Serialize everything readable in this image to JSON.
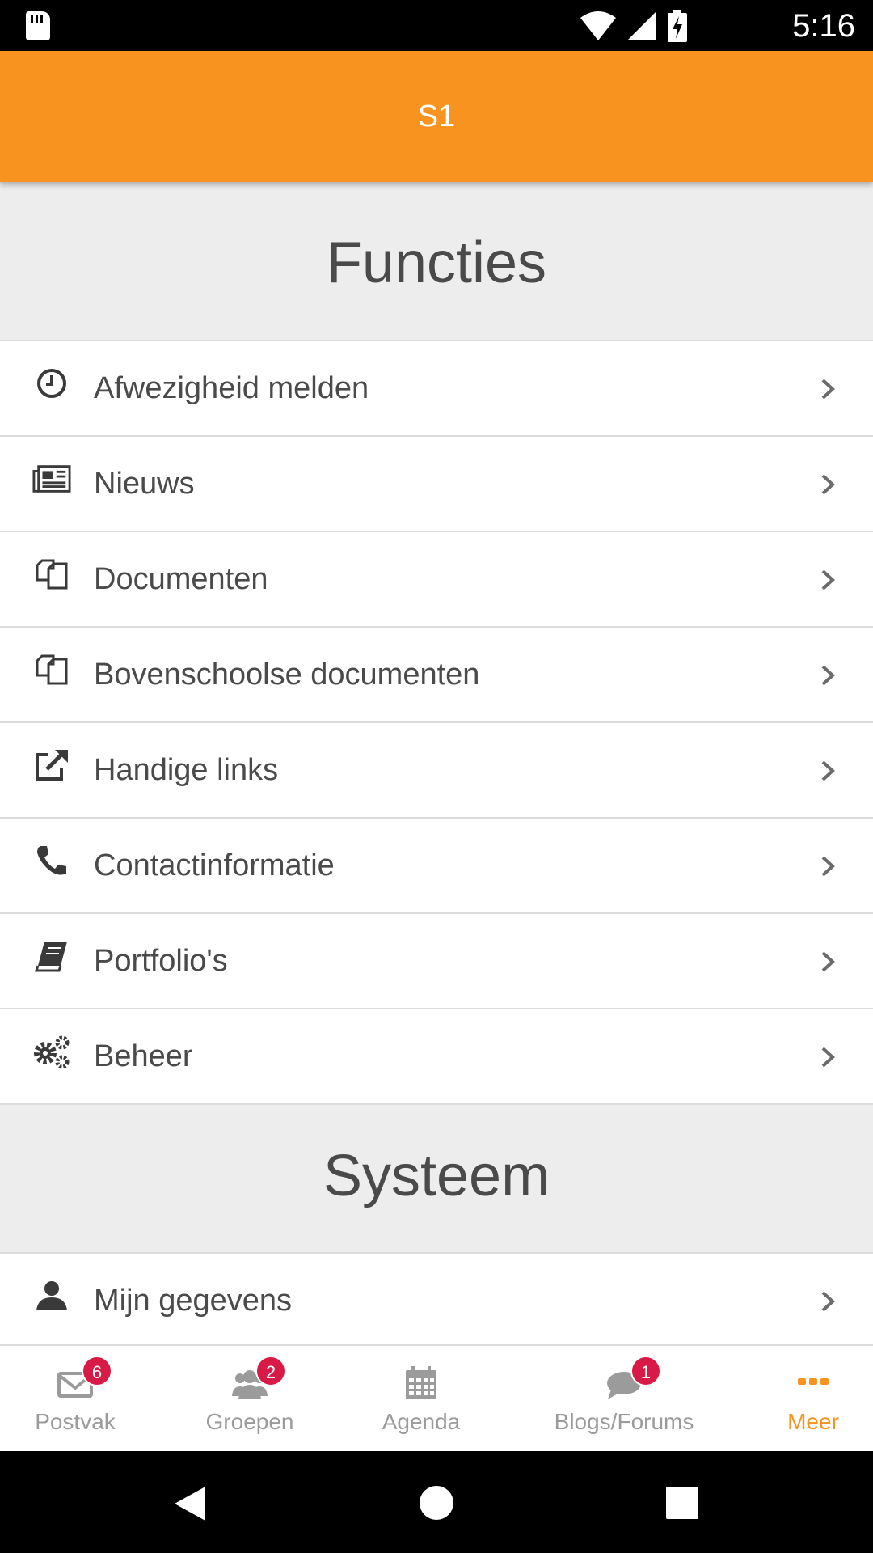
{
  "status_bar": {
    "time": "5:16"
  },
  "app_bar": {
    "title": "S1"
  },
  "sections": {
    "functions_title": "Functies",
    "system_title": "Systeem"
  },
  "functions": [
    {
      "label": "Afwezigheid melden",
      "icon": "clock-icon"
    },
    {
      "label": "Nieuws",
      "icon": "newspaper-icon"
    },
    {
      "label": "Documenten",
      "icon": "documents-icon"
    },
    {
      "label": "Bovenschoolse documenten",
      "icon": "documents-icon"
    },
    {
      "label": "Handige links",
      "icon": "external-link-icon"
    },
    {
      "label": "Contactinformatie",
      "icon": "phone-icon"
    },
    {
      "label": "Portfolio's",
      "icon": "book-icon"
    },
    {
      "label": "Beheer",
      "icon": "gears-icon"
    }
  ],
  "system": [
    {
      "label": "Mijn gegevens",
      "icon": "user-icon"
    }
  ],
  "bottom_nav": [
    {
      "label": "Postvak",
      "icon": "envelope-icon",
      "badge": "6"
    },
    {
      "label": "Groepen",
      "icon": "group-icon",
      "badge": "2"
    },
    {
      "label": "Agenda",
      "icon": "calendar-icon",
      "badge": ""
    },
    {
      "label": "Blogs/Forums",
      "icon": "chat-icon",
      "badge": "1"
    },
    {
      "label": "Meer",
      "icon": "more-icon",
      "badge": "",
      "active": true
    }
  ],
  "colors": {
    "accent": "#f7931e",
    "badge": "#d81b46",
    "text": "#4a4a4a",
    "inactive": "#9b9b9b"
  }
}
